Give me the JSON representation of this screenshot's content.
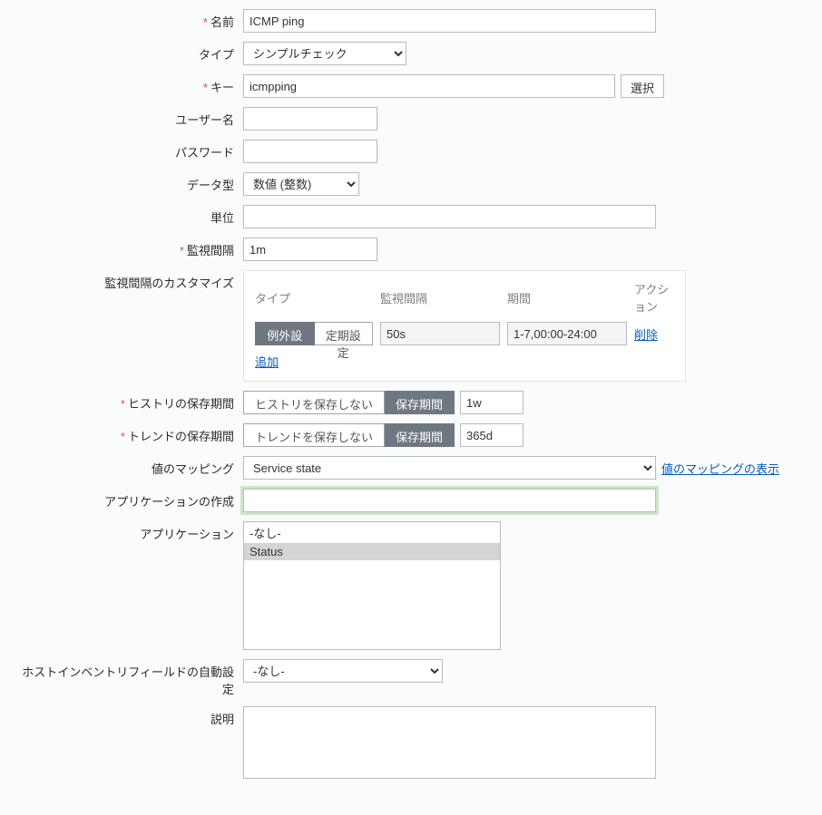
{
  "labels": {
    "name": "名前",
    "type": "タイプ",
    "key": "キー",
    "username": "ユーザー名",
    "password": "パスワード",
    "datatype": "データ型",
    "unit": "単位",
    "interval": "監視間隔",
    "interval_custom": "監視間隔のカスタマイズ",
    "history_period": "ヒストリの保存期間",
    "trend_period": "トレンドの保存期間",
    "value_map": "値のマッピング",
    "app_create": "アプリケーションの作成",
    "applications": "アプリケーション",
    "inventory_auto": "ホストインベントリフィールドの自動設定",
    "description": "説明"
  },
  "values": {
    "name": "ICMP ping",
    "type": "シンプルチェック",
    "key": "icmpping",
    "username": "",
    "password": "",
    "datatype": "数値 (整数)",
    "unit": "",
    "interval": "1m",
    "history_value": "1w",
    "trend_value": "365d",
    "value_map": "Service state",
    "app_create": "",
    "inventory_auto": "-なし-",
    "description": ""
  },
  "buttons": {
    "select": "選択",
    "add": "追加",
    "delete": "削除",
    "history_off": "ヒストリを保存しない",
    "history_on": "保存期間",
    "trend_off": "トレンドを保存しない",
    "trend_on": "保存期間",
    "show_value_map": "値のマッピングの表示"
  },
  "interval_table": {
    "head_type": "タイプ",
    "head_interval": "監視間隔",
    "head_period": "期間",
    "head_action": "アクション",
    "seg_exception": "例外設定",
    "seg_schedule": "定期設定",
    "row_interval": "50s",
    "row_period": "1-7,00:00-24:00"
  },
  "applications": {
    "none": "-なし-",
    "opt1": "Status"
  }
}
